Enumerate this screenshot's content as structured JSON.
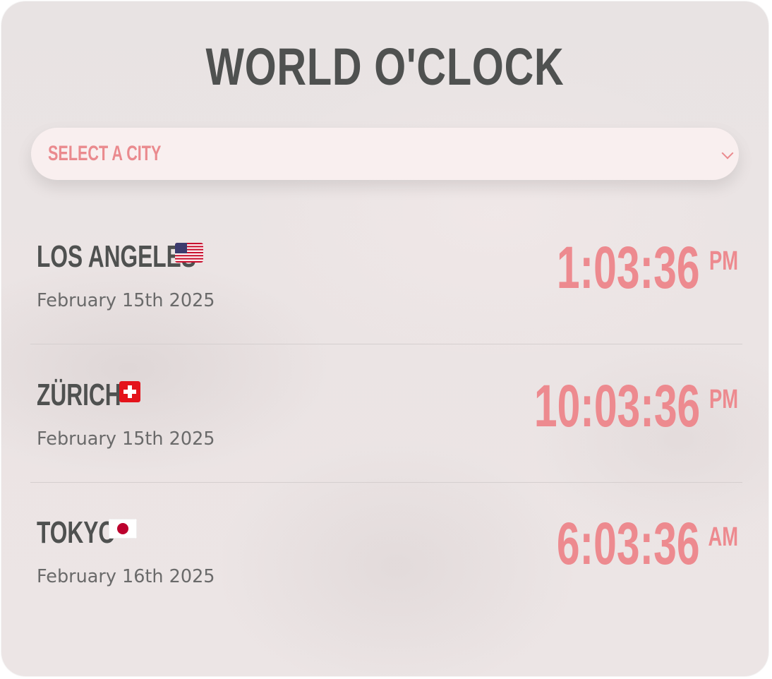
{
  "app": {
    "title": "WORLD O'CLOCK"
  },
  "select": {
    "placeholder": "SELECT A CITY"
  },
  "clocks": [
    {
      "city": "LOS ANGELES",
      "flag": "us-flag",
      "date": "February 15th 2025",
      "time": "1:03:36",
      "period": "PM"
    },
    {
      "city": "ZÜRICH",
      "flag": "swiss-flag",
      "date": "February 15th 2025",
      "time": "10:03:36",
      "period": "PM"
    },
    {
      "city": "TOKYO",
      "flag": "japan-flag",
      "date": "February 16th 2025",
      "time": "6:03:36",
      "period": "AM"
    }
  ],
  "colors": {
    "accent": "#ed8a8f",
    "text": "#4f5150",
    "muted": "#6a6a6a",
    "select_bg": "#f9efef"
  }
}
